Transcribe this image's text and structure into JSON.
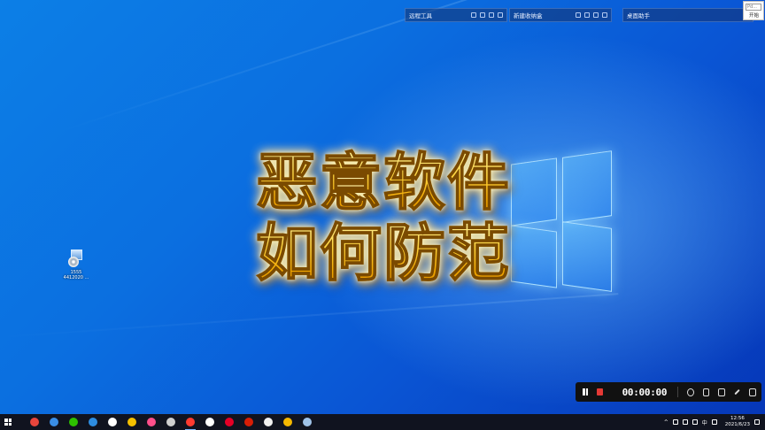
{
  "fences": [
    {
      "title": "远程工具"
    },
    {
      "title": "新建收纳盒"
    },
    {
      "title": "桌面助手"
    }
  ],
  "mini_popup": {
    "input_text": "Pd...",
    "button_label": "开始"
  },
  "desktop_icon": {
    "label": "1555 4412020 ..."
  },
  "overlay_title": {
    "line1": "恶意软件",
    "line2": "如何防范"
  },
  "recorder": {
    "timer": "00:00:00",
    "stop_color": "#e53935"
  },
  "taskbar": {
    "apps": [
      {
        "name": "chrome",
        "color": "#e8453c"
      },
      {
        "name": "browser-blue",
        "color": "#3a8ee6"
      },
      {
        "name": "wechat",
        "color": "#2dc100"
      },
      {
        "name": "edge",
        "color": "#2e8de0"
      },
      {
        "name": "qq",
        "color": "#ffffff"
      },
      {
        "name": "game",
        "color": "#f5c000"
      },
      {
        "name": "pink-app",
        "color": "#ff4f8b"
      },
      {
        "name": "tool",
        "color": "#cfcfcf"
      },
      {
        "name": "recorder",
        "color": "#ff3b30"
      },
      {
        "name": "capcut",
        "color": "#ffffff"
      },
      {
        "name": "netease",
        "color": "#e60026"
      },
      {
        "name": "wps",
        "color": "#d81e06"
      },
      {
        "name": "doc",
        "color": "#f0f0f0"
      },
      {
        "name": "security",
        "color": "#f5b800"
      },
      {
        "name": "setup",
        "color": "#9fc3e8"
      }
    ],
    "tray": {
      "ime": "中",
      "time": "12:56",
      "date": "2021/6/23"
    }
  }
}
